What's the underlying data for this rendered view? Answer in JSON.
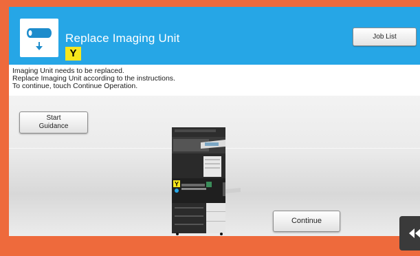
{
  "header": {
    "title": "Replace Imaging Unit",
    "color_badge": "Y",
    "job_list_label": "Job List"
  },
  "message": {
    "line1": "Imaging Unit needs to be replaced.",
    "line2": "Replace Imaging Unit according to the instructions.",
    "line3": "To continue, touch Continue Operation."
  },
  "buttons": {
    "start_guidance_line1": "Start",
    "start_guidance_line2": "Guidance",
    "continue_label": "Continue"
  },
  "machine": {
    "badge": "Y"
  },
  "icons": {
    "header_icon": "imaging-unit-replace-icon",
    "back_icon": "double-left-arrow-icon"
  },
  "colors": {
    "frame": "#ee6a3c",
    "header": "#26a6e6",
    "badge_yellow": "#f7e71c"
  }
}
